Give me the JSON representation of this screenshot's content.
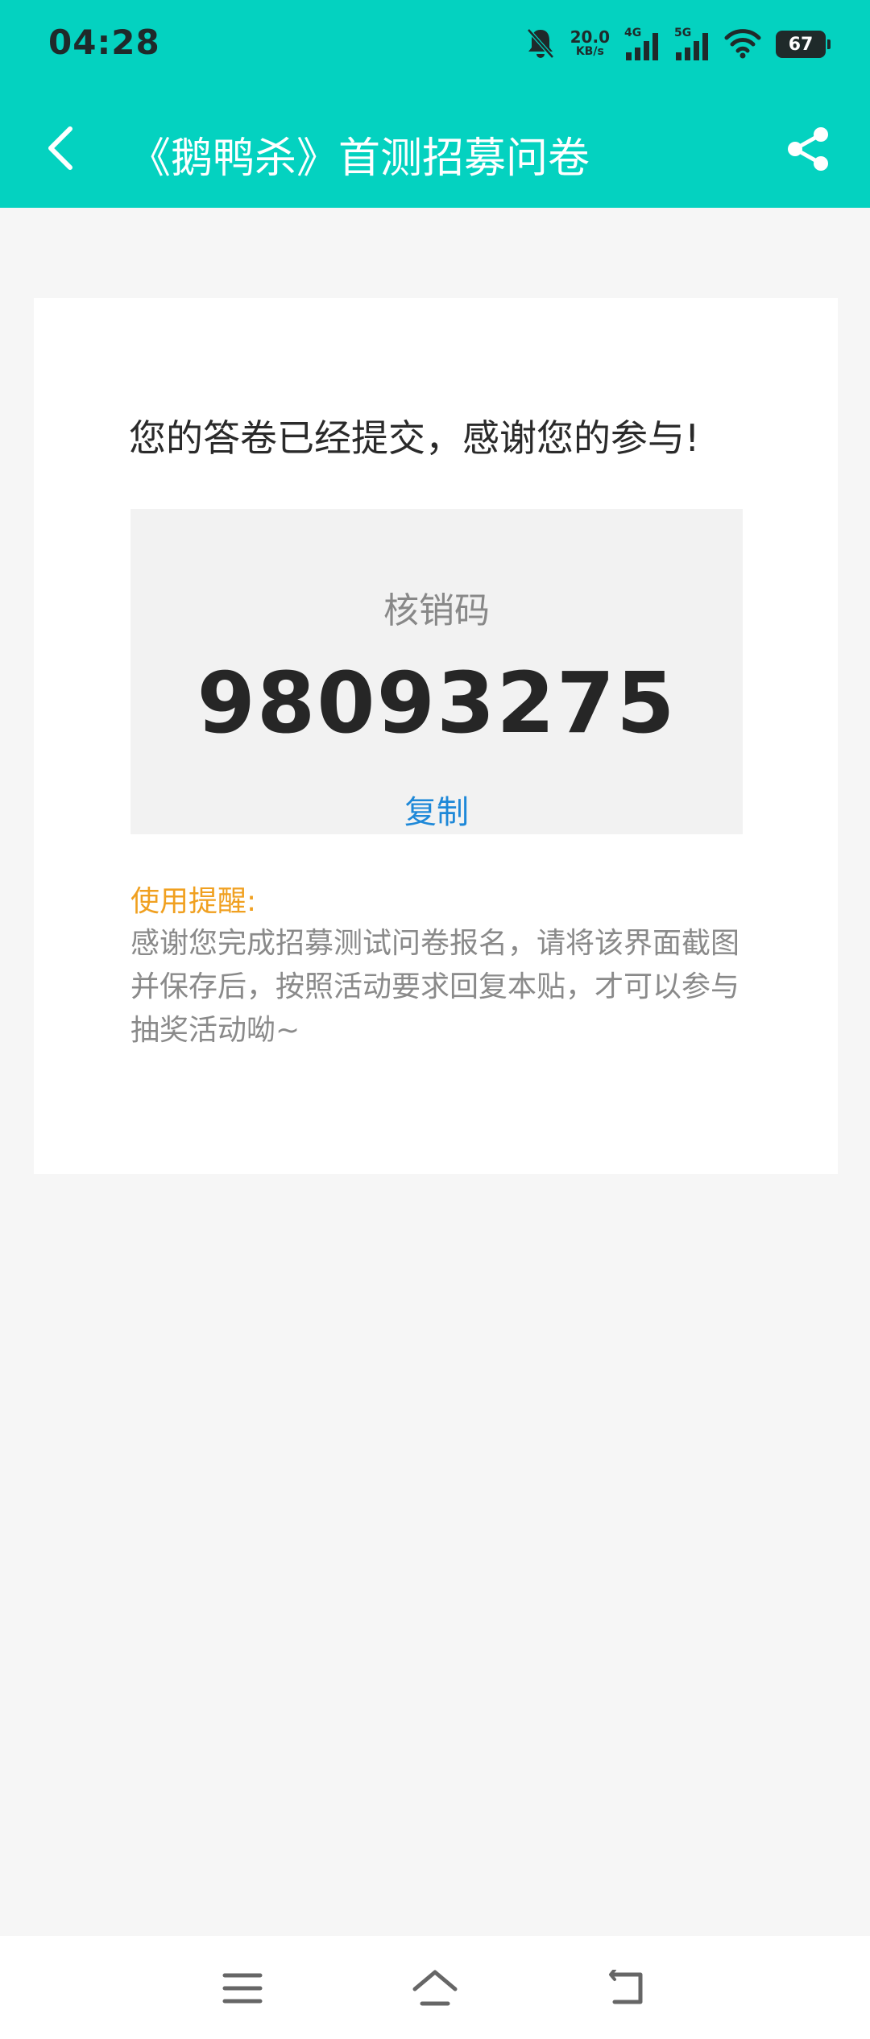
{
  "status_bar": {
    "time": "04:28",
    "net_speed_value": "20.0",
    "net_speed_unit": "KB/s",
    "signal_1_label": "4G",
    "signal_2_label": "5G",
    "battery": "67",
    "icons": [
      "bell-muted-icon",
      "signal-icon",
      "signal-icon",
      "wifi-icon",
      "battery-icon"
    ]
  },
  "header": {
    "title": "《鹅鸭杀》首测招募问卷",
    "back_icon": "chevron-left-icon",
    "share_icon": "share-icon",
    "background_color": "#04d2c0"
  },
  "card": {
    "success_message": "您的答卷已经提交，感谢您的参与!",
    "code_label": "核销码",
    "code_value": "98093275",
    "copy_label": "复制",
    "tip_title": "使用提醒:",
    "tip_body": "感谢您完成招募测试问卷报名，请将该界面截图并保存后，按照活动要求回复本贴，才可以参与抽奖活动呦~",
    "accent_link_color": "#1e88d8",
    "tip_title_color": "#f0a020"
  },
  "bottom_nav": {
    "icons": [
      "menu-icon",
      "home-icon",
      "back-icon"
    ]
  }
}
